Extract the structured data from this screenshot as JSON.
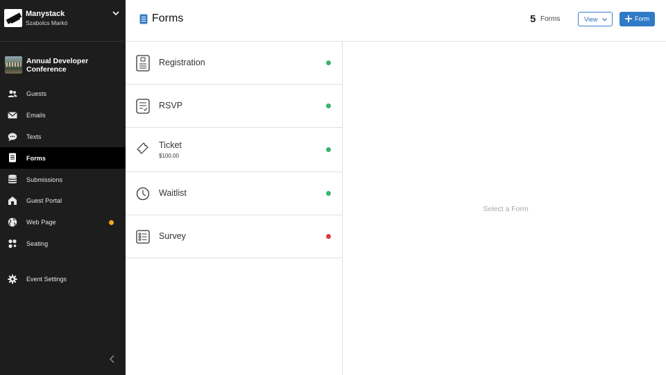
{
  "org": {
    "name": "Manystack",
    "user": "Szabolcs Markó",
    "toggle_icon": "chevron-down-icon"
  },
  "event": {
    "title": "Annual Developer Conference"
  },
  "sidebar": {
    "items": [
      {
        "label": "Guests",
        "icon": "users-icon"
      },
      {
        "label": "Emails",
        "icon": "envelope-icon"
      },
      {
        "label": "Texts",
        "icon": "chat-bubble-icon"
      },
      {
        "label": "Forms",
        "icon": "form-document-icon",
        "active": true
      },
      {
        "label": "Submissions",
        "icon": "database-icon"
      },
      {
        "label": "Guest Portal",
        "icon": "home-icon"
      },
      {
        "label": "Web Page",
        "icon": "globe-icon",
        "badge_color": "#f5a623"
      },
      {
        "label": "Seating",
        "icon": "seating-icon"
      }
    ],
    "settings": {
      "label": "Event Settings",
      "icon": "gear-icon"
    },
    "collapse_icon": "chevron-left-icon"
  },
  "header": {
    "title": "Forms",
    "count": "5",
    "count_label": "Forms",
    "view_label": "View",
    "add_label": "Form"
  },
  "forms": [
    {
      "name": "Registration",
      "icon": "registration-icon",
      "status_color": "#3cb371"
    },
    {
      "name": "RSVP",
      "icon": "checklist-icon",
      "status_color": "#3cb371"
    },
    {
      "name": "Ticket",
      "price": "$100.00",
      "icon": "ticket-icon",
      "status_color": "#3cb371"
    },
    {
      "name": "Waitlist",
      "icon": "clock-icon",
      "status_color": "#3cb371"
    },
    {
      "name": "Survey",
      "icon": "survey-icon",
      "status_color": "#e03a3a"
    }
  ],
  "detail": {
    "placeholder": "Select a Form"
  },
  "colors": {
    "sidebar_bg": "#1d1d1d",
    "active_bg": "#000000",
    "accent": "#2f7ac6",
    "status_active": "#3cb371",
    "status_inactive": "#e03a3a",
    "badge": "#f5a623"
  }
}
